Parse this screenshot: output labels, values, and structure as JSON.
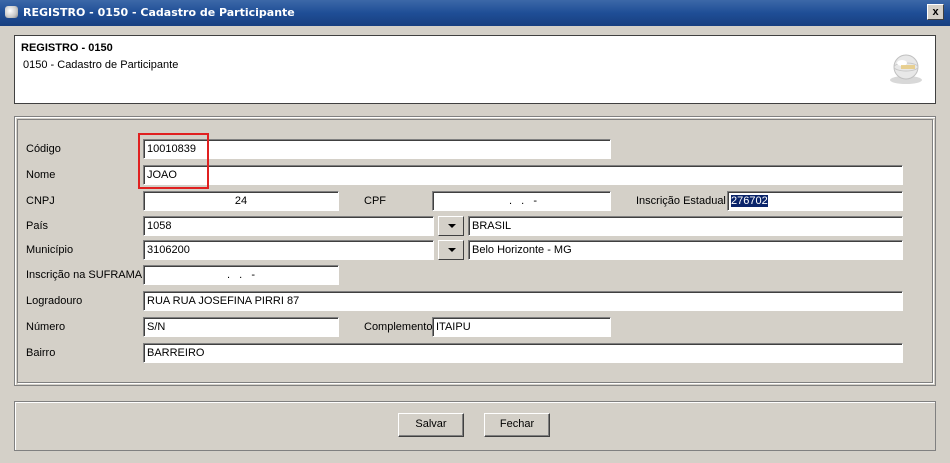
{
  "window": {
    "title": "REGISTRO - 0150 - Cadastro de Participante",
    "close_label": "x"
  },
  "header": {
    "title": "REGISTRO - 0150",
    "subtitle": "0150 - Cadastro de Participante"
  },
  "form": {
    "codigo": {
      "label": "Código",
      "value": "10010839"
    },
    "nome": {
      "label": "Nome",
      "value": "JOAO"
    },
    "cnpj": {
      "label": "CNPJ",
      "value": "24"
    },
    "cpf": {
      "label": "CPF",
      "value": " .   .   -"
    },
    "inscricao_estadual": {
      "label": "Inscrição Estadual",
      "value": "276702"
    },
    "pais": {
      "label": "País",
      "code": "1058",
      "name": "BRASIL"
    },
    "municipio": {
      "label": "Município",
      "code": "3106200",
      "name": "Belo Horizonte - MG"
    },
    "suframa": {
      "label": "Inscrição na SUFRAMA",
      "value": ".   .   -"
    },
    "logradouro": {
      "label": "Logradouro",
      "value": "RUA RUA JOSEFINA PIRRI 87"
    },
    "numero": {
      "label": "Número",
      "value": "S/N"
    },
    "complemento": {
      "label": "Complemento",
      "value": "ITAIPU"
    },
    "bairro": {
      "label": "Bairro",
      "value": "BARREIRO"
    }
  },
  "buttons": {
    "save": "Salvar",
    "close": "Fechar"
  },
  "icons": {
    "logo": "globe-logo-icon",
    "dropdown": "chevron-down-icon"
  },
  "colors": {
    "titlebar": "#1f4e96",
    "highlight": "#e02020",
    "selection": "#0a246a"
  }
}
